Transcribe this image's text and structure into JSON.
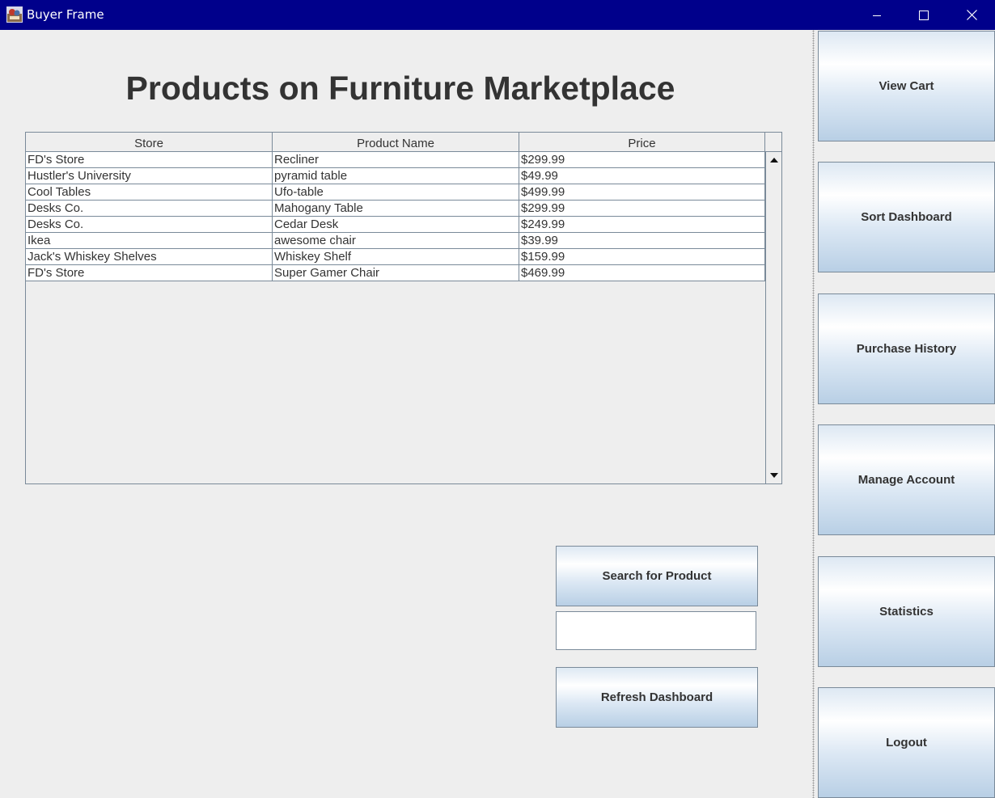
{
  "window": {
    "title": "Buyer Frame",
    "icons": {
      "app": "java-app-icon",
      "minimize": "minimize-icon",
      "maximize": "maximize-icon",
      "close": "close-icon"
    }
  },
  "main": {
    "heading": "Products on Furniture Marketplace",
    "table": {
      "columns": [
        "Store",
        "Product Name",
        "Price"
      ],
      "rows": [
        [
          "FD's Store",
          "Recliner",
          "$299.99"
        ],
        [
          "Hustler's University",
          "pyramid table",
          "$49.99"
        ],
        [
          "Cool Tables",
          "Ufo-table",
          "$499.99"
        ],
        [
          "Desks Co.",
          "Mahogany Table",
          "$299.99"
        ],
        [
          "Desks Co.",
          "Cedar Desk",
          "$249.99"
        ],
        [
          "Ikea",
          "awesome chair",
          "$39.99"
        ],
        [
          "Jack's Whiskey Shelves",
          "Whiskey Shelf",
          "$159.99"
        ],
        [
          "FD's Store",
          "Super Gamer Chair",
          "$469.99"
        ]
      ]
    },
    "search_button": "Search for Product",
    "search_value": "",
    "refresh_button": "Refresh Dashboard"
  },
  "sidebar": {
    "buttons": [
      "View Cart",
      "Sort Dashboard",
      "Purchase History",
      "Manage Account",
      "Statistics",
      "Logout"
    ]
  },
  "colors": {
    "titlebar": "#00008b",
    "background": "#eeeeee",
    "border": "#7a8a99",
    "text": "#333333"
  }
}
